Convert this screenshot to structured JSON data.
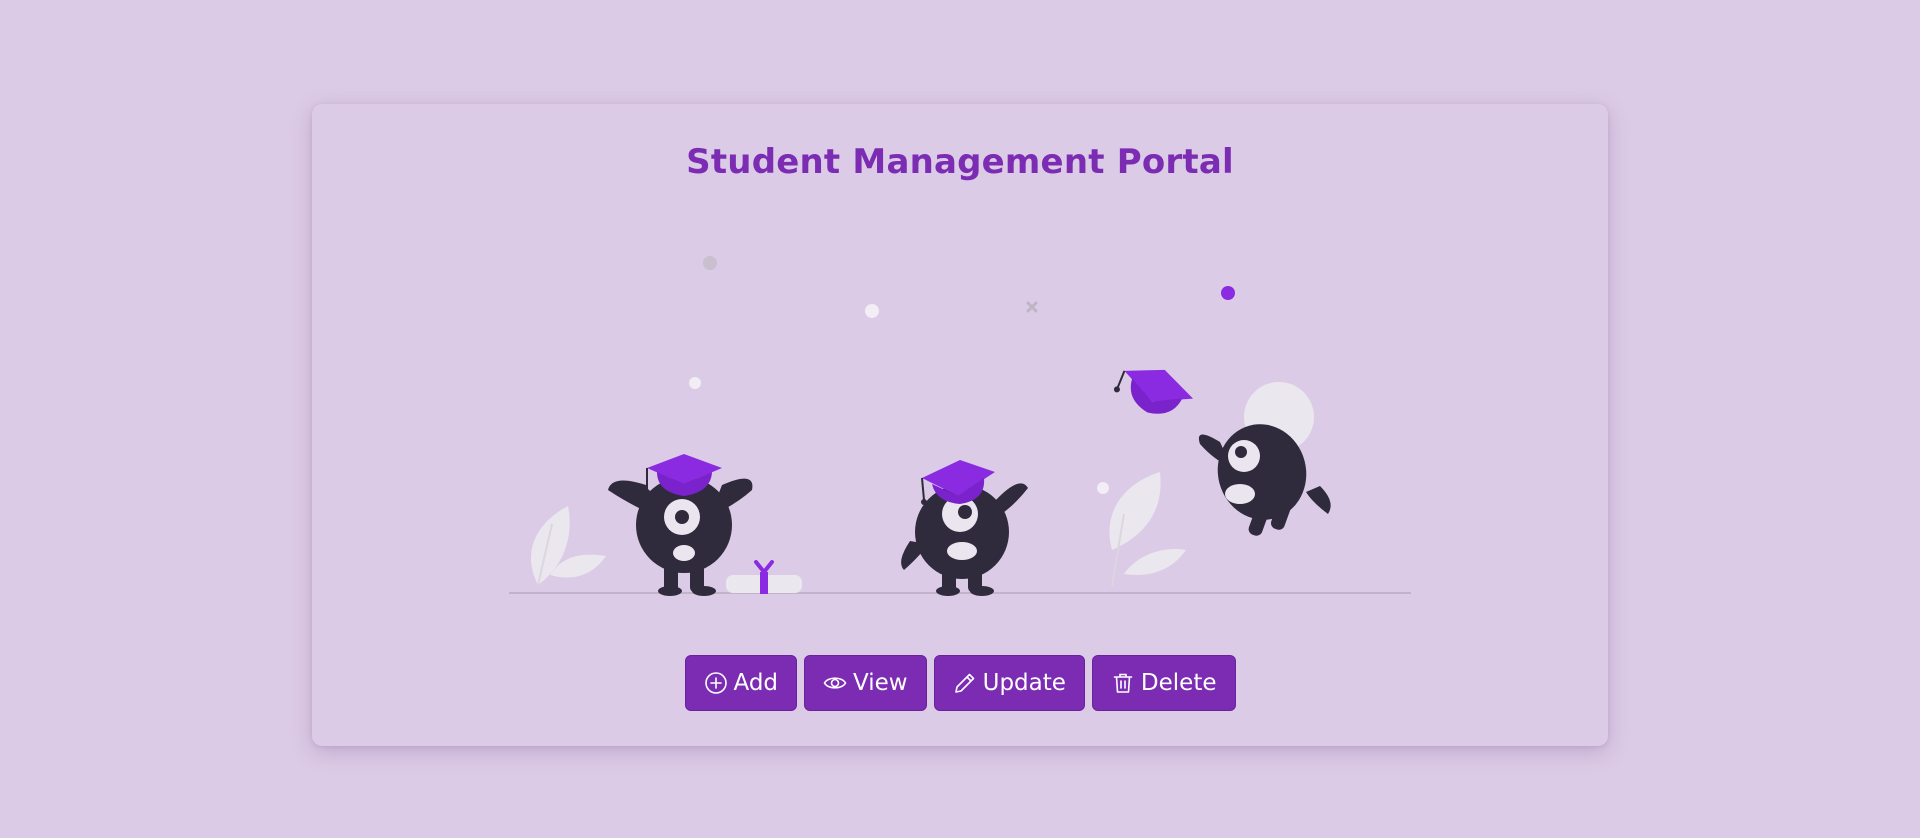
{
  "page": {
    "title": "Student Management Portal"
  },
  "colors": {
    "background": "#dccbe6",
    "card": "#dbcbe6",
    "accent": "#7b2cb3",
    "illustration_purple": "#8a2be2",
    "character": "#2f2b3c"
  },
  "illustration": {
    "name": "graduation-celebration",
    "icons": [
      "graduation-cap-icon",
      "diploma-icon",
      "leaf-icon"
    ]
  },
  "actions": [
    {
      "label": "Add",
      "icon": "plus-circle-icon"
    },
    {
      "label": "View",
      "icon": "eye-icon"
    },
    {
      "label": "Update",
      "icon": "pencil-icon"
    },
    {
      "label": "Delete",
      "icon": "trash-icon"
    }
  ]
}
